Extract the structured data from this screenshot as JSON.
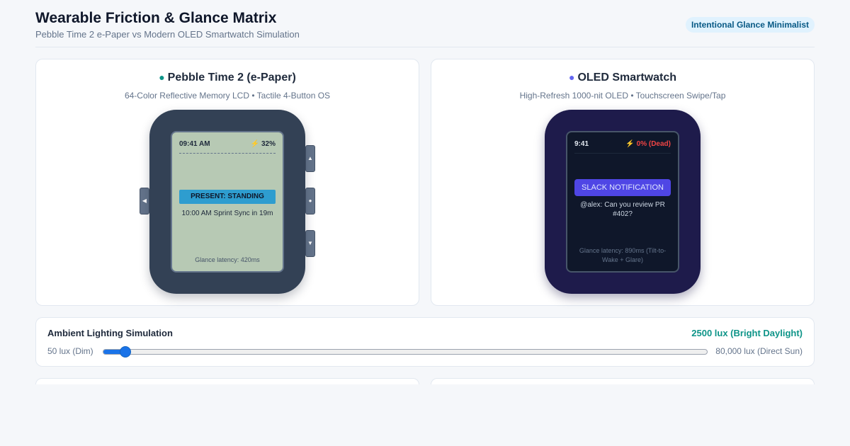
{
  "header": {
    "title": "Wearable Friction & Glance Matrix",
    "subtitle": "Pebble Time 2 e-Paper vs Modern OLED Smartwatch Simulation",
    "badge": "Intentional Glance Minimalist"
  },
  "pebble": {
    "dot": "●",
    "title": "Pebble Time 2 (e-Paper)",
    "subtitle": "64-Color Reflective Memory LCD • Tactile 4-Button OS",
    "buttons": {
      "back": "◀",
      "up": "▲",
      "select": "●",
      "down": "▼"
    },
    "screen": {
      "time": "09:41 AM",
      "battery_icon": "⚡",
      "battery": "32%",
      "banner": "PRESENT: STANDING",
      "event": "10:00 AM Sprint Sync in 19m",
      "latency": "Glance latency: 420ms"
    }
  },
  "oled": {
    "dot": "●",
    "title": "OLED Smartwatch",
    "subtitle": "High-Refresh 1000-nit OLED • Touchscreen Swipe/Tap",
    "screen": {
      "time": "9:41",
      "battery_icon": "⚡",
      "battery": "0% (Dead)",
      "banner": "SLACK NOTIFICATION",
      "message": "@alex: Can you review PR #402?",
      "latency": "Glance latency: 890ms (Tilt-to-Wake + Glare)"
    }
  },
  "ambient": {
    "title": "Ambient Lighting Simulation",
    "value_label": "2500 lux (Bright Daylight)",
    "min_label": "50 lux (Dim)",
    "max_label": "80,000 lux (Direct Sun)",
    "slider_fraction": 0.038
  },
  "colors": {
    "accent_teal": "#0d9488",
    "accent_indigo": "#6366f1",
    "pebble_body": "#334155",
    "pebble_screen": "#b7c9b4",
    "oled_body": "#1e1b4b",
    "oled_screen": "#0f172a",
    "slider_blue": "#1a73e8"
  },
  "icons": {
    "card_status": "dot-icon",
    "battery": "lightning-bolt-icon",
    "pebble_back": "triangle-left-icon",
    "pebble_up": "triangle-up-icon",
    "pebble_select": "dot-icon",
    "pebble_down": "triangle-down-icon"
  }
}
